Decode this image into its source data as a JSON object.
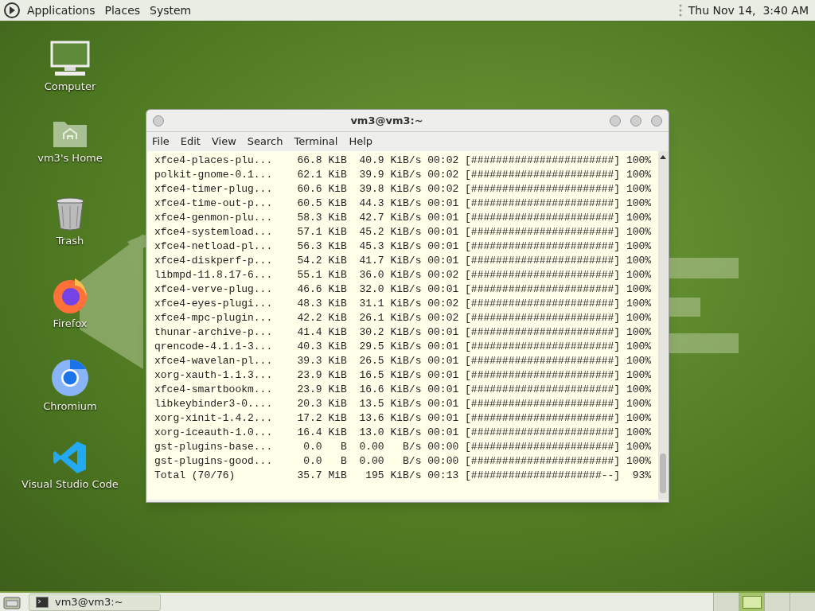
{
  "top_panel": {
    "menus": [
      "Applications",
      "Places",
      "System"
    ],
    "clock": "Thu Nov 14,  3:40 AM"
  },
  "desktop_icons": [
    {
      "kind": "computer",
      "label": "Computer"
    },
    {
      "kind": "home",
      "label": "vm3's Home"
    },
    {
      "kind": "trash",
      "label": "Trash"
    },
    {
      "kind": "firefox",
      "label": "Firefox"
    },
    {
      "kind": "chromium",
      "label": "Chromium"
    },
    {
      "kind": "vscode",
      "label": "Visual Studio Code"
    }
  ],
  "terminal": {
    "title": "vm3@vm3:~",
    "menu": [
      "File",
      "Edit",
      "View",
      "Search",
      "Terminal",
      "Help"
    ],
    "lines": [
      "xfce4-places-plu...    66.8 KiB  40.9 KiB/s 00:02 [#######################] 100%",
      "polkit-gnome-0.1...    62.1 KiB  39.9 KiB/s 00:02 [#######################] 100%",
      "xfce4-timer-plug...    60.6 KiB  39.8 KiB/s 00:02 [#######################] 100%",
      "xfce4-time-out-p...    60.5 KiB  44.3 KiB/s 00:01 [#######################] 100%",
      "xfce4-genmon-plu...    58.3 KiB  42.7 KiB/s 00:01 [#######################] 100%",
      "xfce4-systemload...    57.1 KiB  45.2 KiB/s 00:01 [#######################] 100%",
      "xfce4-netload-pl...    56.3 KiB  45.3 KiB/s 00:01 [#######################] 100%",
      "xfce4-diskperf-p...    54.2 KiB  41.7 KiB/s 00:01 [#######################] 100%",
      "libmpd-11.8.17-6...    55.1 KiB  36.0 KiB/s 00:02 [#######################] 100%",
      "xfce4-verve-plug...    46.6 KiB  32.0 KiB/s 00:01 [#######################] 100%",
      "xfce4-eyes-plugi...    48.3 KiB  31.1 KiB/s 00:02 [#######################] 100%",
      "xfce4-mpc-plugin...    42.2 KiB  26.1 KiB/s 00:02 [#######################] 100%",
      "thunar-archive-p...    41.4 KiB  30.2 KiB/s 00:01 [#######################] 100%",
      "qrencode-4.1.1-3...    40.3 KiB  29.5 KiB/s 00:01 [#######################] 100%",
      "xfce4-wavelan-pl...    39.3 KiB  26.5 KiB/s 00:01 [#######################] 100%",
      "xorg-xauth-1.1.3...    23.9 KiB  16.5 KiB/s 00:01 [#######################] 100%",
      "xfce4-smartbookm...    23.9 KiB  16.6 KiB/s 00:01 [#######################] 100%",
      "libkeybinder3-0....    20.3 KiB  13.5 KiB/s 00:01 [#######################] 100%",
      "xorg-xinit-1.4.2...    17.2 KiB  13.6 KiB/s 00:01 [#######################] 100%",
      "xorg-iceauth-1.0...    16.4 KiB  13.0 KiB/s 00:01 [#######################] 100%",
      "gst-plugins-base...     0.0   B  0.00   B/s 00:00 [#######################] 100%",
      "gst-plugins-good...     0.0   B  0.00   B/s 00:00 [#######################] 100%",
      "Total (70/76)          35.7 MiB   195 KiB/s 00:13 [#####################--]  93%"
    ]
  },
  "taskbar": {
    "tasks": [
      {
        "label": "vm3@vm3:~"
      }
    ],
    "workspaces": [
      {
        "selected": false
      },
      {
        "selected": true
      },
      {
        "selected": false
      },
      {
        "selected": false
      }
    ]
  }
}
